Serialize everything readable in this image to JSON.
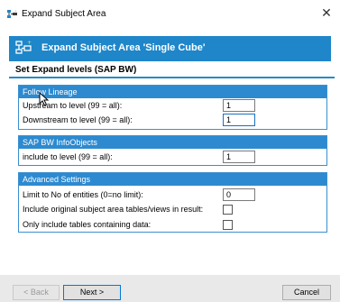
{
  "window": {
    "title": "Expand Subject Area",
    "close_glyph": "✕"
  },
  "banner": {
    "title": "Expand Subject Area 'Single Cube'",
    "icon": "subject-area-icon"
  },
  "section": {
    "heading": "Set Expand levels (SAP BW)"
  },
  "follow_lineage": {
    "header": "Follow Lineage",
    "upstream_label": "Upstream to level (99 = all):",
    "upstream_value": "1",
    "downstream_label": "Downstream to level (99 = all):",
    "downstream_value": "1"
  },
  "infoobjects": {
    "header": "SAP BW InfoObjects",
    "include_label": "include to level (99 = all):",
    "include_value": "1"
  },
  "advanced": {
    "header": "Advanced Settings",
    "limit_label": "Limit to No of entities (0=no limit):",
    "limit_value": "0",
    "include_original_label": "Include original subject area tables/views in result:",
    "include_original_checked": false,
    "only_data_label": "Only include tables containing data:",
    "only_data_checked": false
  },
  "buttons": {
    "back": "< Back",
    "next": "Next >",
    "cancel": "Cancel"
  },
  "colors": {
    "accent": "#1e86c9",
    "panel_header": "#2d8ad0",
    "footer": "#e9e9e9"
  }
}
